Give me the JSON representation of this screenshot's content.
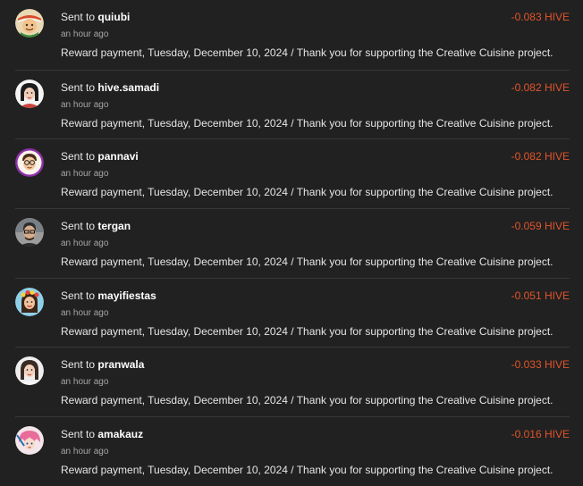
{
  "transfers": [
    {
      "prefix": "Sent to",
      "recipient": "quiubi",
      "time": "an hour ago",
      "memo": "Reward payment, Tuesday, December 10, 2024 / Thank you for supporting the Creative Cuisine project.",
      "amount": "-0.083 HIVE",
      "avatar_icon": "cartoon-face-avatar"
    },
    {
      "prefix": "Sent to",
      "recipient": "hive.samadi",
      "time": "an hour ago",
      "memo": "Reward payment, Tuesday, December 10, 2024 / Thank you for supporting the Creative Cuisine project.",
      "amount": "-0.082 HIVE",
      "avatar_icon": "woman-photo-avatar"
    },
    {
      "prefix": "Sent to",
      "recipient": "pannavi",
      "time": "an hour ago",
      "memo": "Reward payment, Tuesday, December 10, 2024 / Thank you for supporting the Creative Cuisine project.",
      "amount": "-0.082 HIVE",
      "avatar_icon": "cartoon-glasses-avatar"
    },
    {
      "prefix": "Sent to",
      "recipient": "tergan",
      "time": "an hour ago",
      "memo": "Reward payment, Tuesday, December 10, 2024 / Thank you for supporting the Creative Cuisine project.",
      "amount": "-0.059 HIVE",
      "avatar_icon": "man-photo-avatar"
    },
    {
      "prefix": "Sent to",
      "recipient": "mayifiestas",
      "time": "an hour ago",
      "memo": "Reward payment, Tuesday, December 10, 2024 / Thank you for supporting the Creative Cuisine project.",
      "amount": "-0.051 HIVE",
      "avatar_icon": "cartoon-flower-avatar"
    },
    {
      "prefix": "Sent to",
      "recipient": "pranwala",
      "time": "an hour ago",
      "memo": "Reward payment, Tuesday, December 10, 2024 / Thank you for supporting the Creative Cuisine project.",
      "amount": "-0.033 HIVE",
      "avatar_icon": "woman-photo-avatar"
    },
    {
      "prefix": "Sent to",
      "recipient": "amakauz",
      "time": "an hour ago",
      "memo": "Reward payment, Tuesday, December 10, 2024 / Thank you for supporting the Creative Cuisine project.",
      "amount": "-0.016 HIVE",
      "avatar_icon": "anime-avatar"
    }
  ],
  "colors": {
    "background": "#212121",
    "divider": "#383838",
    "amount_negative": "#e0542b",
    "secondary_text": "#a6a6a6"
  }
}
